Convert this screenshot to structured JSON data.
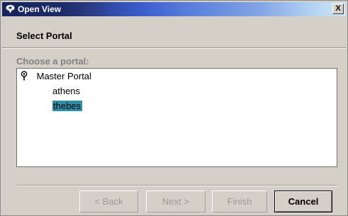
{
  "window": {
    "title": "Open View",
    "close_label": "X"
  },
  "header": {
    "heading": "Select Portal"
  },
  "chooser": {
    "label": "Choose a portal:",
    "tree": {
      "root": "Master Portal",
      "children": [
        "athens",
        "thebes"
      ],
      "selected": "thebes"
    }
  },
  "buttons": {
    "back": "< Back",
    "next": "Next >",
    "finish": "Finish",
    "cancel": "Cancel"
  },
  "colors": {
    "selection": "#2f8fa8",
    "dialog_bg": "#d4d0c8",
    "title_start": "#14235e",
    "title_end": "#cfe4f6"
  },
  "icons": {
    "app": "pin-icon",
    "tree_root": "pin-icon",
    "close": "close-icon"
  }
}
